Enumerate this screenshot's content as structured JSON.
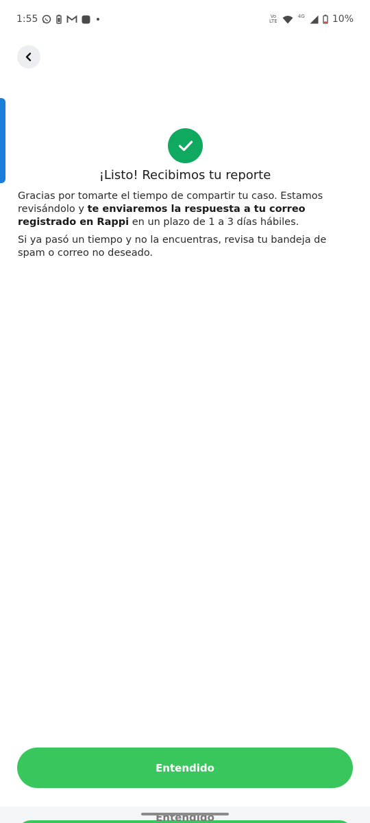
{
  "status_bar": {
    "time": "1:55",
    "volte_label": "Vo",
    "lte_label": "LTE",
    "network_label": "4G",
    "battery": "10%",
    "icons": [
      "whatsapp-icon",
      "battery-saver-icon",
      "gmail-icon",
      "app-square-icon",
      "dot-icon",
      "wifi-icon",
      "signal-icon",
      "battery-icon"
    ]
  },
  "header": {
    "back_icon": "chevron-left-icon"
  },
  "content": {
    "title": "¡Listo! Recibimos tu reporte",
    "p1_a": "Gracias por tomarte el tiempo de compartir tu caso. Estamos revisándolo y ",
    "p1_bold": "te enviaremos la respuesta a tu correo registrado en Rappi",
    "p1_b": " en un plazo de 1 a 3 días hábiles.",
    "p2": "Si ya pasó un tiempo y no la encuentras, revisa tu bandeja de spam o correo no deseado."
  },
  "actions": {
    "primary_label": "Entendido",
    "ghost_label": "Entendido"
  },
  "colors": {
    "success": "#0fa960",
    "button": "#39c75d",
    "edge_tab": "#1a7fd9"
  }
}
